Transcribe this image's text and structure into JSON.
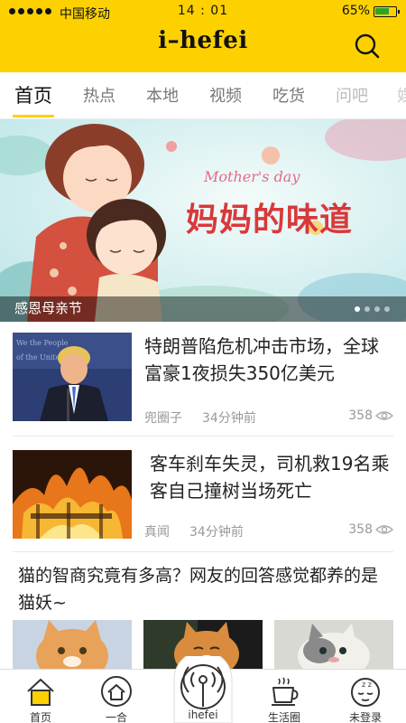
{
  "status": {
    "carrier": "中国移动",
    "time": "14 : 01",
    "battery": "65%"
  },
  "header": {
    "brand": "i–hefei",
    "search_icon": "search-icon"
  },
  "tabs": [
    {
      "label": "首页",
      "active": true
    },
    {
      "label": "热点"
    },
    {
      "label": "本地"
    },
    {
      "label": "视频"
    },
    {
      "label": "吃货"
    },
    {
      "label": "问吧"
    },
    {
      "label": "娱"
    }
  ],
  "banner": {
    "script_text": "Mother's day",
    "title": "妈妈的味道",
    "caption": "感恩母亲节",
    "dots": 4,
    "active_dot": 0
  },
  "news": [
    {
      "title": "特朗普陷危机冲击市场，全球富豪1夜损失350亿美元",
      "source": "兜圈子",
      "time": "34分钟前",
      "views": "358"
    },
    {
      "title": "客车刹车失灵，司机救19名乘客自己撞树当场死亡",
      "source": "真闻",
      "time": "34分钟前",
      "views": "358"
    }
  ],
  "article3": {
    "title": "猫的智商究竟有多高？网友的回答感觉都养的是猫妖~"
  },
  "bottom_nav": [
    {
      "label": "首页",
      "icon": "home-icon",
      "active": true
    },
    {
      "label": "一合",
      "icon": "house-circle-icon"
    },
    {
      "label": "ihefei",
      "icon": "broadcast-icon"
    },
    {
      "label": "生活圈",
      "icon": "coffee-cup-icon"
    },
    {
      "label": "未登录",
      "icon": "sleeping-face-icon"
    }
  ],
  "colors": {
    "brand_yellow": "#fdd100",
    "banner_title_red": "#d9383a"
  }
}
